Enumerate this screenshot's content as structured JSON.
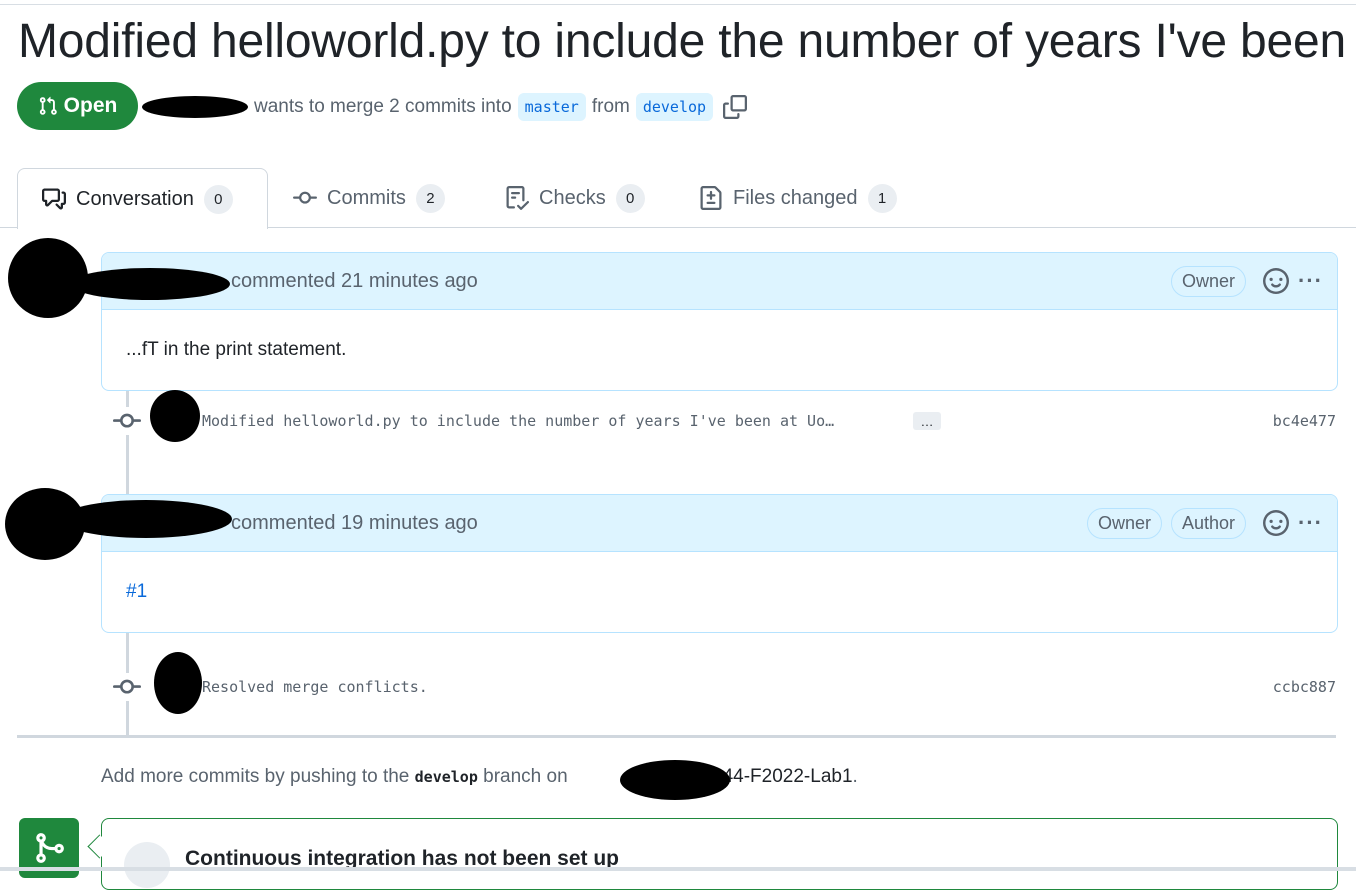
{
  "pr": {
    "title": "Modified helloworld.py to include the number of years I've been",
    "state": "Open",
    "merge_text": "wants to merge 2 commits into",
    "base_branch": "master",
    "from_text": "from",
    "head_branch": "develop"
  },
  "tabs": [
    {
      "label": "Conversation",
      "count": "0",
      "icon": "comment-discussion-icon"
    },
    {
      "label": "Commits",
      "count": "2",
      "icon": "git-commit-icon"
    },
    {
      "label": "Checks",
      "count": "0",
      "icon": "checklist-icon"
    },
    {
      "label": "Files changed",
      "count": "1",
      "icon": "file-diff-icon"
    }
  ],
  "timeline": {
    "comment1": {
      "action": "commented 21 minutes ago",
      "badges": [
        "Owner"
      ],
      "body": "...fT in the print statement."
    },
    "commit1": {
      "message": "Modified helloworld.py to include the number of years I've been at Uo…",
      "ellipsis": "…",
      "sha": "bc4e477"
    },
    "comment2": {
      "action": "commented 19 minutes ago",
      "badges": [
        "Owner",
        "Author"
      ],
      "body": "#1"
    },
    "commit2": {
      "message": "Resolved merge conflicts.",
      "sha": "ccbc887"
    }
  },
  "push_note": {
    "prefix": "Add more commits by pushing to the",
    "branch": "develop",
    "middle": "branch on",
    "repo": "/ECE444-F2022-Lab1",
    "suffix": "."
  },
  "ci": {
    "title": "Continuous integration has not been set up"
  },
  "colors": {
    "open_green": "#1f883d",
    "link_blue": "#0969da",
    "comment_header_bg": "#ddf4ff"
  }
}
